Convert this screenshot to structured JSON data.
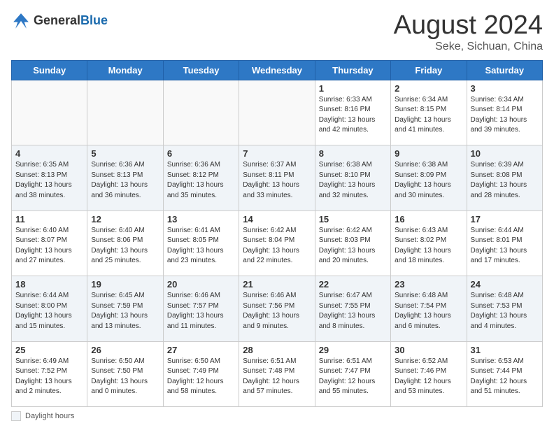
{
  "header": {
    "logo_general": "General",
    "logo_blue": "Blue",
    "month_title": "August 2024",
    "location": "Seke, Sichuan, China"
  },
  "footer": {
    "label": "Daylight hours"
  },
  "days_of_week": [
    "Sunday",
    "Monday",
    "Tuesday",
    "Wednesday",
    "Thursday",
    "Friday",
    "Saturday"
  ],
  "weeks": [
    [
      {
        "day": "",
        "info": "",
        "shade": false
      },
      {
        "day": "",
        "info": "",
        "shade": false
      },
      {
        "day": "",
        "info": "",
        "shade": false
      },
      {
        "day": "",
        "info": "",
        "shade": false
      },
      {
        "day": "1",
        "info": "Sunrise: 6:33 AM\nSunset: 8:16 PM\nDaylight: 13 hours\nand 42 minutes.",
        "shade": false
      },
      {
        "day": "2",
        "info": "Sunrise: 6:34 AM\nSunset: 8:15 PM\nDaylight: 13 hours\nand 41 minutes.",
        "shade": false
      },
      {
        "day": "3",
        "info": "Sunrise: 6:34 AM\nSunset: 8:14 PM\nDaylight: 13 hours\nand 39 minutes.",
        "shade": false
      }
    ],
    [
      {
        "day": "4",
        "info": "Sunrise: 6:35 AM\nSunset: 8:13 PM\nDaylight: 13 hours\nand 38 minutes.",
        "shade": true
      },
      {
        "day": "5",
        "info": "Sunrise: 6:36 AM\nSunset: 8:13 PM\nDaylight: 13 hours\nand 36 minutes.",
        "shade": true
      },
      {
        "day": "6",
        "info": "Sunrise: 6:36 AM\nSunset: 8:12 PM\nDaylight: 13 hours\nand 35 minutes.",
        "shade": true
      },
      {
        "day": "7",
        "info": "Sunrise: 6:37 AM\nSunset: 8:11 PM\nDaylight: 13 hours\nand 33 minutes.",
        "shade": true
      },
      {
        "day": "8",
        "info": "Sunrise: 6:38 AM\nSunset: 8:10 PM\nDaylight: 13 hours\nand 32 minutes.",
        "shade": true
      },
      {
        "day": "9",
        "info": "Sunrise: 6:38 AM\nSunset: 8:09 PM\nDaylight: 13 hours\nand 30 minutes.",
        "shade": true
      },
      {
        "day": "10",
        "info": "Sunrise: 6:39 AM\nSunset: 8:08 PM\nDaylight: 13 hours\nand 28 minutes.",
        "shade": true
      }
    ],
    [
      {
        "day": "11",
        "info": "Sunrise: 6:40 AM\nSunset: 8:07 PM\nDaylight: 13 hours\nand 27 minutes.",
        "shade": false
      },
      {
        "day": "12",
        "info": "Sunrise: 6:40 AM\nSunset: 8:06 PM\nDaylight: 13 hours\nand 25 minutes.",
        "shade": false
      },
      {
        "day": "13",
        "info": "Sunrise: 6:41 AM\nSunset: 8:05 PM\nDaylight: 13 hours\nand 23 minutes.",
        "shade": false
      },
      {
        "day": "14",
        "info": "Sunrise: 6:42 AM\nSunset: 8:04 PM\nDaylight: 13 hours\nand 22 minutes.",
        "shade": false
      },
      {
        "day": "15",
        "info": "Sunrise: 6:42 AM\nSunset: 8:03 PM\nDaylight: 13 hours\nand 20 minutes.",
        "shade": false
      },
      {
        "day": "16",
        "info": "Sunrise: 6:43 AM\nSunset: 8:02 PM\nDaylight: 13 hours\nand 18 minutes.",
        "shade": false
      },
      {
        "day": "17",
        "info": "Sunrise: 6:44 AM\nSunset: 8:01 PM\nDaylight: 13 hours\nand 17 minutes.",
        "shade": false
      }
    ],
    [
      {
        "day": "18",
        "info": "Sunrise: 6:44 AM\nSunset: 8:00 PM\nDaylight: 13 hours\nand 15 minutes.",
        "shade": true
      },
      {
        "day": "19",
        "info": "Sunrise: 6:45 AM\nSunset: 7:59 PM\nDaylight: 13 hours\nand 13 minutes.",
        "shade": true
      },
      {
        "day": "20",
        "info": "Sunrise: 6:46 AM\nSunset: 7:57 PM\nDaylight: 13 hours\nand 11 minutes.",
        "shade": true
      },
      {
        "day": "21",
        "info": "Sunrise: 6:46 AM\nSunset: 7:56 PM\nDaylight: 13 hours\nand 9 minutes.",
        "shade": true
      },
      {
        "day": "22",
        "info": "Sunrise: 6:47 AM\nSunset: 7:55 PM\nDaylight: 13 hours\nand 8 minutes.",
        "shade": true
      },
      {
        "day": "23",
        "info": "Sunrise: 6:48 AM\nSunset: 7:54 PM\nDaylight: 13 hours\nand 6 minutes.",
        "shade": true
      },
      {
        "day": "24",
        "info": "Sunrise: 6:48 AM\nSunset: 7:53 PM\nDaylight: 13 hours\nand 4 minutes.",
        "shade": true
      }
    ],
    [
      {
        "day": "25",
        "info": "Sunrise: 6:49 AM\nSunset: 7:52 PM\nDaylight: 13 hours\nand 2 minutes.",
        "shade": false
      },
      {
        "day": "26",
        "info": "Sunrise: 6:50 AM\nSunset: 7:50 PM\nDaylight: 13 hours\nand 0 minutes.",
        "shade": false
      },
      {
        "day": "27",
        "info": "Sunrise: 6:50 AM\nSunset: 7:49 PM\nDaylight: 12 hours\nand 58 minutes.",
        "shade": false
      },
      {
        "day": "28",
        "info": "Sunrise: 6:51 AM\nSunset: 7:48 PM\nDaylight: 12 hours\nand 57 minutes.",
        "shade": false
      },
      {
        "day": "29",
        "info": "Sunrise: 6:51 AM\nSunset: 7:47 PM\nDaylight: 12 hours\nand 55 minutes.",
        "shade": false
      },
      {
        "day": "30",
        "info": "Sunrise: 6:52 AM\nSunset: 7:46 PM\nDaylight: 12 hours\nand 53 minutes.",
        "shade": false
      },
      {
        "day": "31",
        "info": "Sunrise: 6:53 AM\nSunset: 7:44 PM\nDaylight: 12 hours\nand 51 minutes.",
        "shade": false
      }
    ]
  ]
}
